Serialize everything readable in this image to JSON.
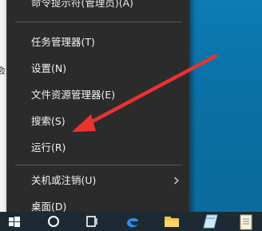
{
  "desktop": {
    "edge_char": "会"
  },
  "context_menu": {
    "items": [
      {
        "label": "命令提示符(管理员)(A)"
      },
      {
        "label": "任务管理器(T)"
      },
      {
        "label": "设置(N)"
      },
      {
        "label": "文件资源管理器(E)"
      },
      {
        "label": "搜索(S)"
      },
      {
        "label": "运行(R)"
      },
      {
        "label": "关机或注销(U)",
        "has_submenu": true
      },
      {
        "label": "桌面(D)"
      }
    ]
  },
  "annotation": {
    "arrow_color": "#e8332f",
    "points_to": "运行(R)"
  },
  "taskbar": {
    "background": "#1d2a33",
    "icons": [
      "windows-start-icon",
      "cortana-search-icon",
      "task-view-icon",
      "edge-browser-icon",
      "file-explorer-icon",
      "store-icon",
      "notepad-icon",
      "document-icon"
    ]
  }
}
